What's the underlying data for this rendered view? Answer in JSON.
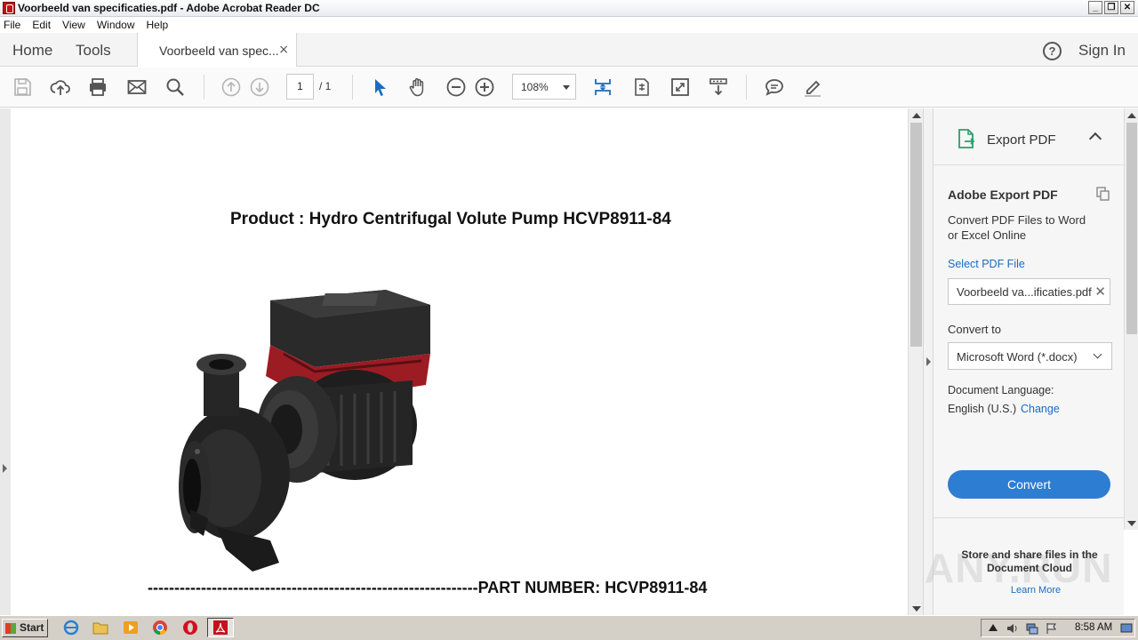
{
  "window": {
    "title": "Voorbeeld van specificaties.pdf - Adobe Acrobat Reader DC",
    "controls": [
      "_",
      "❐",
      "✕"
    ]
  },
  "menu": [
    "File",
    "Edit",
    "View",
    "Window",
    "Help"
  ],
  "tabs": {
    "home": "Home",
    "tools": "Tools",
    "document": "Voorbeeld van spec...",
    "close": "×",
    "help": "?",
    "sign_in": "Sign In"
  },
  "toolbar": {
    "page_current": "1",
    "page_total": "/  1",
    "zoom": "108%",
    "icons": [
      "save-icon",
      "upload-icon",
      "print-icon",
      "email-icon",
      "search-icon",
      "prev-page-icon",
      "next-page-icon",
      "select-cursor-icon",
      "hand-icon",
      "zoom-out-icon",
      "zoom-in-icon",
      "fit-page-icon",
      "rotate-icon",
      "full-screen-icon",
      "scroll-mode-icon",
      "comment-icon",
      "highlight-icon"
    ]
  },
  "document": {
    "heading": "Product : Hydro Centrifugal Volute Pump HCVP8911-84",
    "part_number_line": "--------------------------------------------------------------PART NUMBER: HCVP8911-84",
    "image": "pump-image"
  },
  "right_pane": {
    "export_title": "Export PDF",
    "section_title": "Adobe Export PDF",
    "description": "Convert PDF Files to Word or Excel Online",
    "select_file_link": "Select PDF File",
    "file_value": "Voorbeeld va...ificaties.pdf",
    "convert_to_label": "Convert to",
    "convert_to_value": "Microsoft Word (*.docx)",
    "doc_language_label": "Document Language:",
    "doc_language_value": "English (U.S.)",
    "change_link": "Change",
    "convert_button": "Convert",
    "store_text": "Store and share files in the Document Cloud",
    "learn_more": "Learn More",
    "watermark": "ANY.RUN"
  },
  "taskbar": {
    "start": "Start",
    "clock": "8:58 AM"
  },
  "colors": {
    "accent_blue": "#2d7dd2",
    "link_blue": "#1a6bc1",
    "acrobat_red": "#c4111b"
  }
}
